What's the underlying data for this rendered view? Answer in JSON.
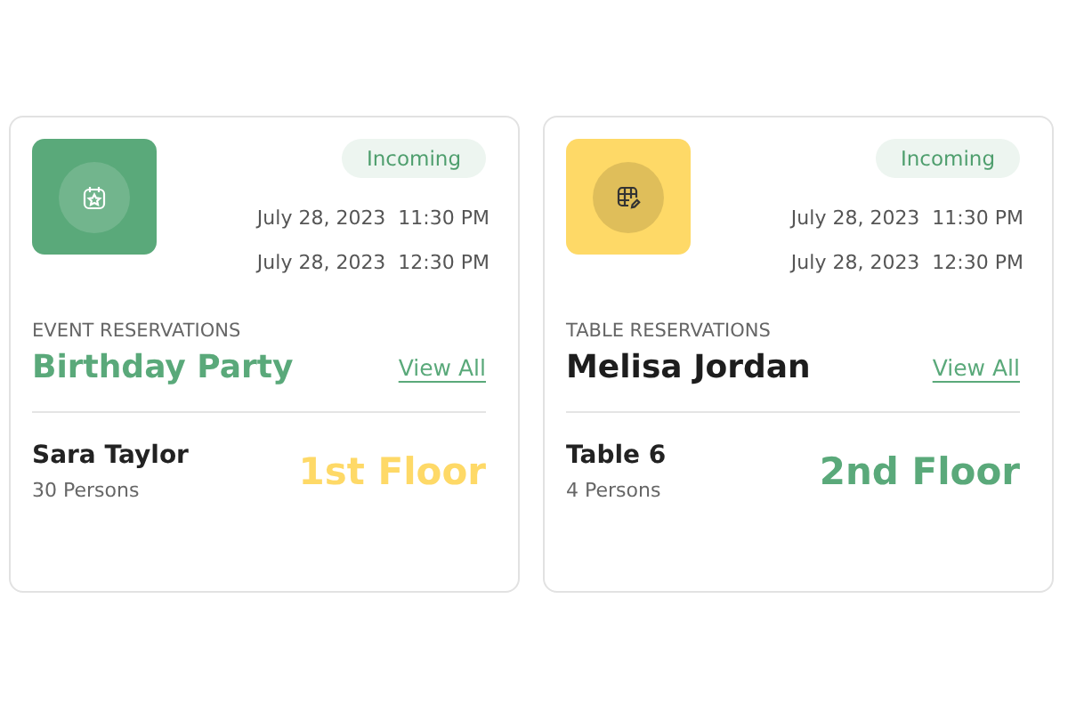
{
  "cards": [
    {
      "kind": "event",
      "color": "#5aa97a",
      "status": "Incoming",
      "times": [
        "July 28, 2023  11:30 PM",
        "July 28, 2023  12:30 PM"
      ],
      "category": "EVENT RESERVATIONS",
      "title": "Birthday Party",
      "link": "View All",
      "name": "Sara Taylor",
      "persons": "30 Persons",
      "floor": "1st Floor"
    },
    {
      "kind": "table",
      "color": "#fed967",
      "status": "Incoming",
      "times": [
        "July 28, 2023  11:30 PM",
        "July 28, 2023  12:30 PM"
      ],
      "category": "TABLE RESERVATIONS",
      "title": "Melisa Jordan",
      "link": "View All",
      "name": "Table 6",
      "persons": "4 Persons",
      "floor": "2nd Floor"
    }
  ]
}
